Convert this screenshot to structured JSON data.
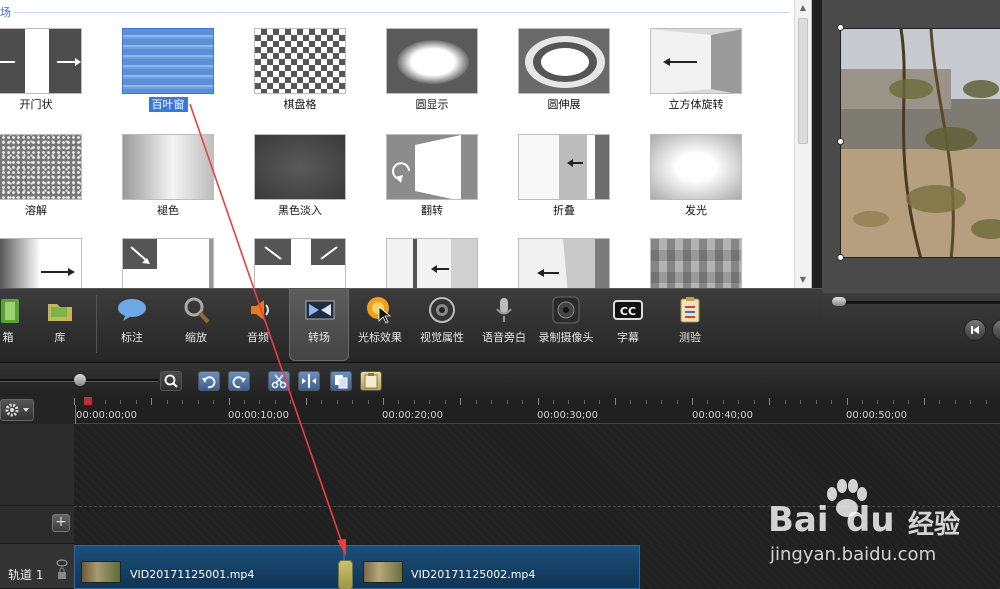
{
  "gallery": {
    "section_label": "场",
    "tiles": [
      {
        "label": "开门状"
      },
      {
        "label": "百叶窗"
      },
      {
        "label": "棋盘格"
      },
      {
        "label": "圆显示"
      },
      {
        "label": "圆伸展"
      },
      {
        "label": "立方体旋转"
      },
      {
        "label": "溶解"
      },
      {
        "label": "褪色"
      },
      {
        "label": "黑色淡入"
      },
      {
        "label": "翻转"
      },
      {
        "label": "折叠"
      },
      {
        "label": "发光"
      }
    ],
    "selected": "百叶窗"
  },
  "toolbar": {
    "items": [
      {
        "label": "箱",
        "icon": "film-icon"
      },
      {
        "label": "库",
        "icon": "folder-icon"
      },
      {
        "label": "标注",
        "icon": "callout-icon"
      },
      {
        "label": "缩放",
        "icon": "zoom-icon"
      },
      {
        "label": "音频",
        "icon": "speaker-icon"
      },
      {
        "label": "转场",
        "icon": "transition-icon"
      },
      {
        "label": "光标效果",
        "icon": "cursor-icon"
      },
      {
        "label": "视觉属性",
        "icon": "visual-icon"
      },
      {
        "label": "语音旁白",
        "icon": "microphone-icon"
      },
      {
        "label": "录制摄像头",
        "icon": "webcam-icon"
      },
      {
        "label": "字幕",
        "icon": "cc-icon"
      },
      {
        "label": "测验",
        "icon": "quiz-icon"
      }
    ],
    "active": "转场",
    "cc_text": "CC"
  },
  "timeline": {
    "ruler_labels": [
      "00:00:00;00",
      "00:00:10;00",
      "00:00:20;00",
      "00:00:30;00",
      "00:00:40;00",
      "00:00:50;00"
    ],
    "track_name": "轨道 1",
    "clips": [
      {
        "name": "VID20171125001.mp4"
      },
      {
        "name": "VID20171125002.mp4"
      }
    ]
  },
  "watermark": {
    "brand": "Bai",
    "brand_tail": "du",
    "cn": "经验",
    "url": "jingyan.baidu.com"
  },
  "colors": {
    "selection": "#3a78d8",
    "clip": "#1d4f7a",
    "annotation_arrow": "#e84040"
  }
}
